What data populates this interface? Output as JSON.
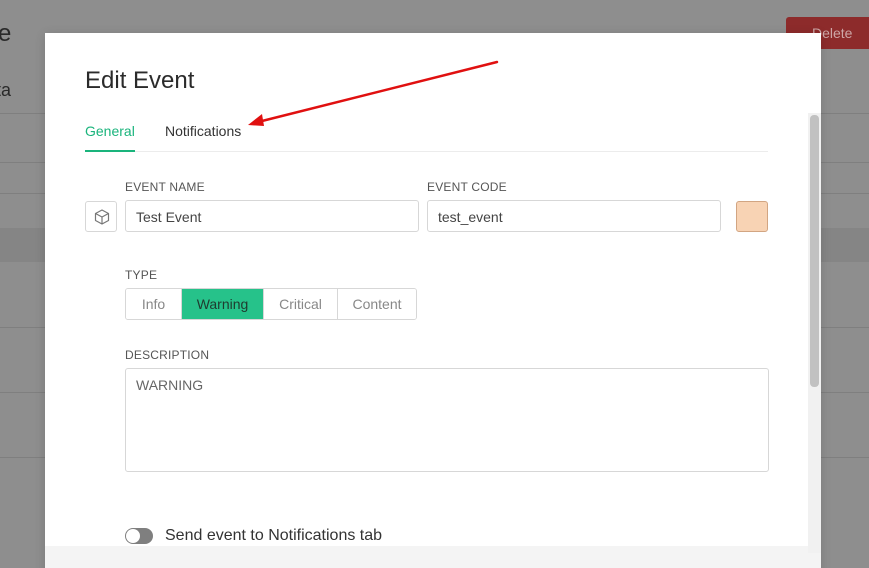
{
  "background": {
    "title_fragment": "e",
    "subtitle_fragment": "ta",
    "delete_label": "Delete"
  },
  "modal": {
    "title": "Edit Event",
    "tabs": [
      {
        "label": "General",
        "active": true
      },
      {
        "label": "Notifications",
        "active": false
      }
    ],
    "event_name": {
      "label": "EVENT NAME",
      "value": "Test Event"
    },
    "event_code": {
      "label": "EVENT CODE",
      "value": "test_event"
    },
    "color_swatch": "#f8d3b4",
    "type": {
      "label": "TYPE",
      "options": [
        "Info",
        "Warning",
        "Critical",
        "Content"
      ],
      "selected": "Warning"
    },
    "description": {
      "label": "DESCRIPTION",
      "value": "WARNING"
    },
    "notifications_toggle": {
      "label": "Send event to Notifications tab",
      "on": false
    },
    "icon": "cube-icon"
  },
  "colors": {
    "accent": "#1ab47c",
    "active_type": "#26c28a",
    "annotation_arrow": "#e01010"
  }
}
